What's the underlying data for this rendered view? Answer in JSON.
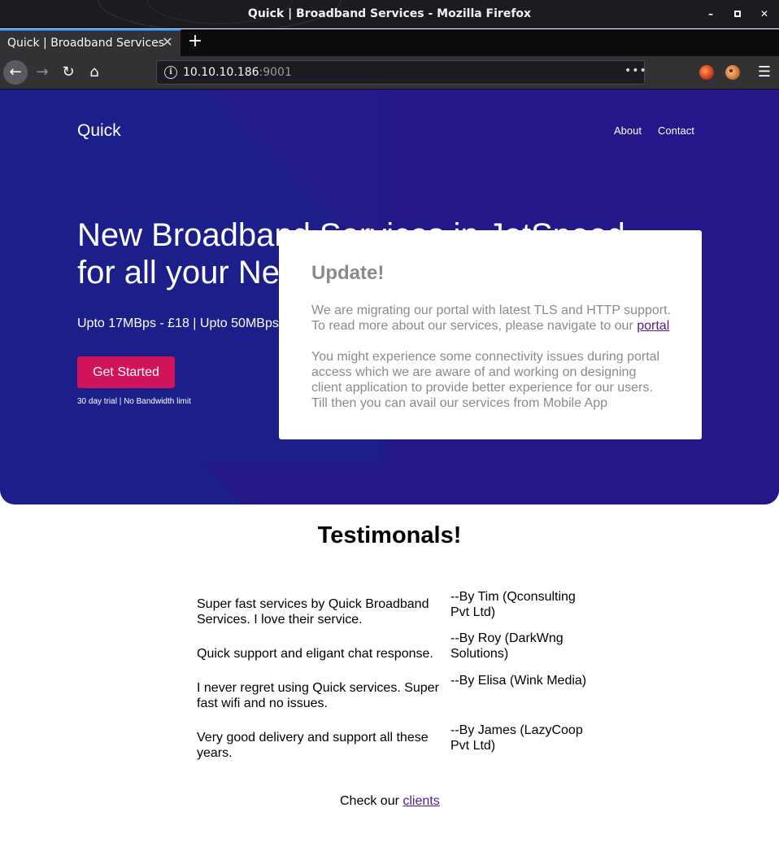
{
  "browser": {
    "window_title": "Quick | Broadband Services - Mozilla Firefox",
    "tab_title": "Quick | Broadband Services",
    "url_host": "10.10.10.186",
    "url_port": ":9001",
    "url_more": "•••",
    "icons": {
      "minimize": "–",
      "maximize": "□",
      "close": "✕",
      "tab_close": "✕",
      "new_tab": "+",
      "back": "←",
      "forward": "→",
      "reload": "↻",
      "home": "⌂",
      "info": "i",
      "menu": "☰"
    }
  },
  "site": {
    "brand": "Quick",
    "nav": {
      "about": "About",
      "contact": "Contact"
    },
    "headline": "New Broadband Services in JetSpeed for all your Ne",
    "subline": "Upto 17MBps - £18 | Upto 50MBps",
    "cta": "Get Started",
    "note": "30 day trial | No Bandwidth limit",
    "colors": {
      "hero": "#1c1f89",
      "cta": "#d1145a",
      "link": "#551a8b"
    }
  },
  "modal": {
    "title": "Update!",
    "p1_text": "We are migrating our portal with latest TLS and HTTP support. To read more about our services, please navigate to our",
    "p1_link": "portal",
    "p2_text": "You might experience some connectivity issues during portal access which we are aware of and working on designing client application to provide better experience for our users. Till then you can avail our services from Mobile App"
  },
  "testimonials": {
    "title": "Testimonals!",
    "items": [
      {
        "text": "Super fast services by Quick Broadband Services. I love their service.",
        "by": "--By Tim (Qconsulting Pvt Ltd)"
      },
      {
        "text": "Quick support and eligant chat response.",
        "by": "--By Roy (DarkWng Solutions)"
      },
      {
        "text": "I never regret using Quick services. Super fast wifi and no issues.",
        "by": "--By Elisa (Wink Media)"
      },
      {
        "text": "Very good delivery and support all these years.",
        "by": "--By James (LazyCoop Pvt Ltd)"
      }
    ],
    "check_text": "Check our",
    "check_link": "clients"
  }
}
